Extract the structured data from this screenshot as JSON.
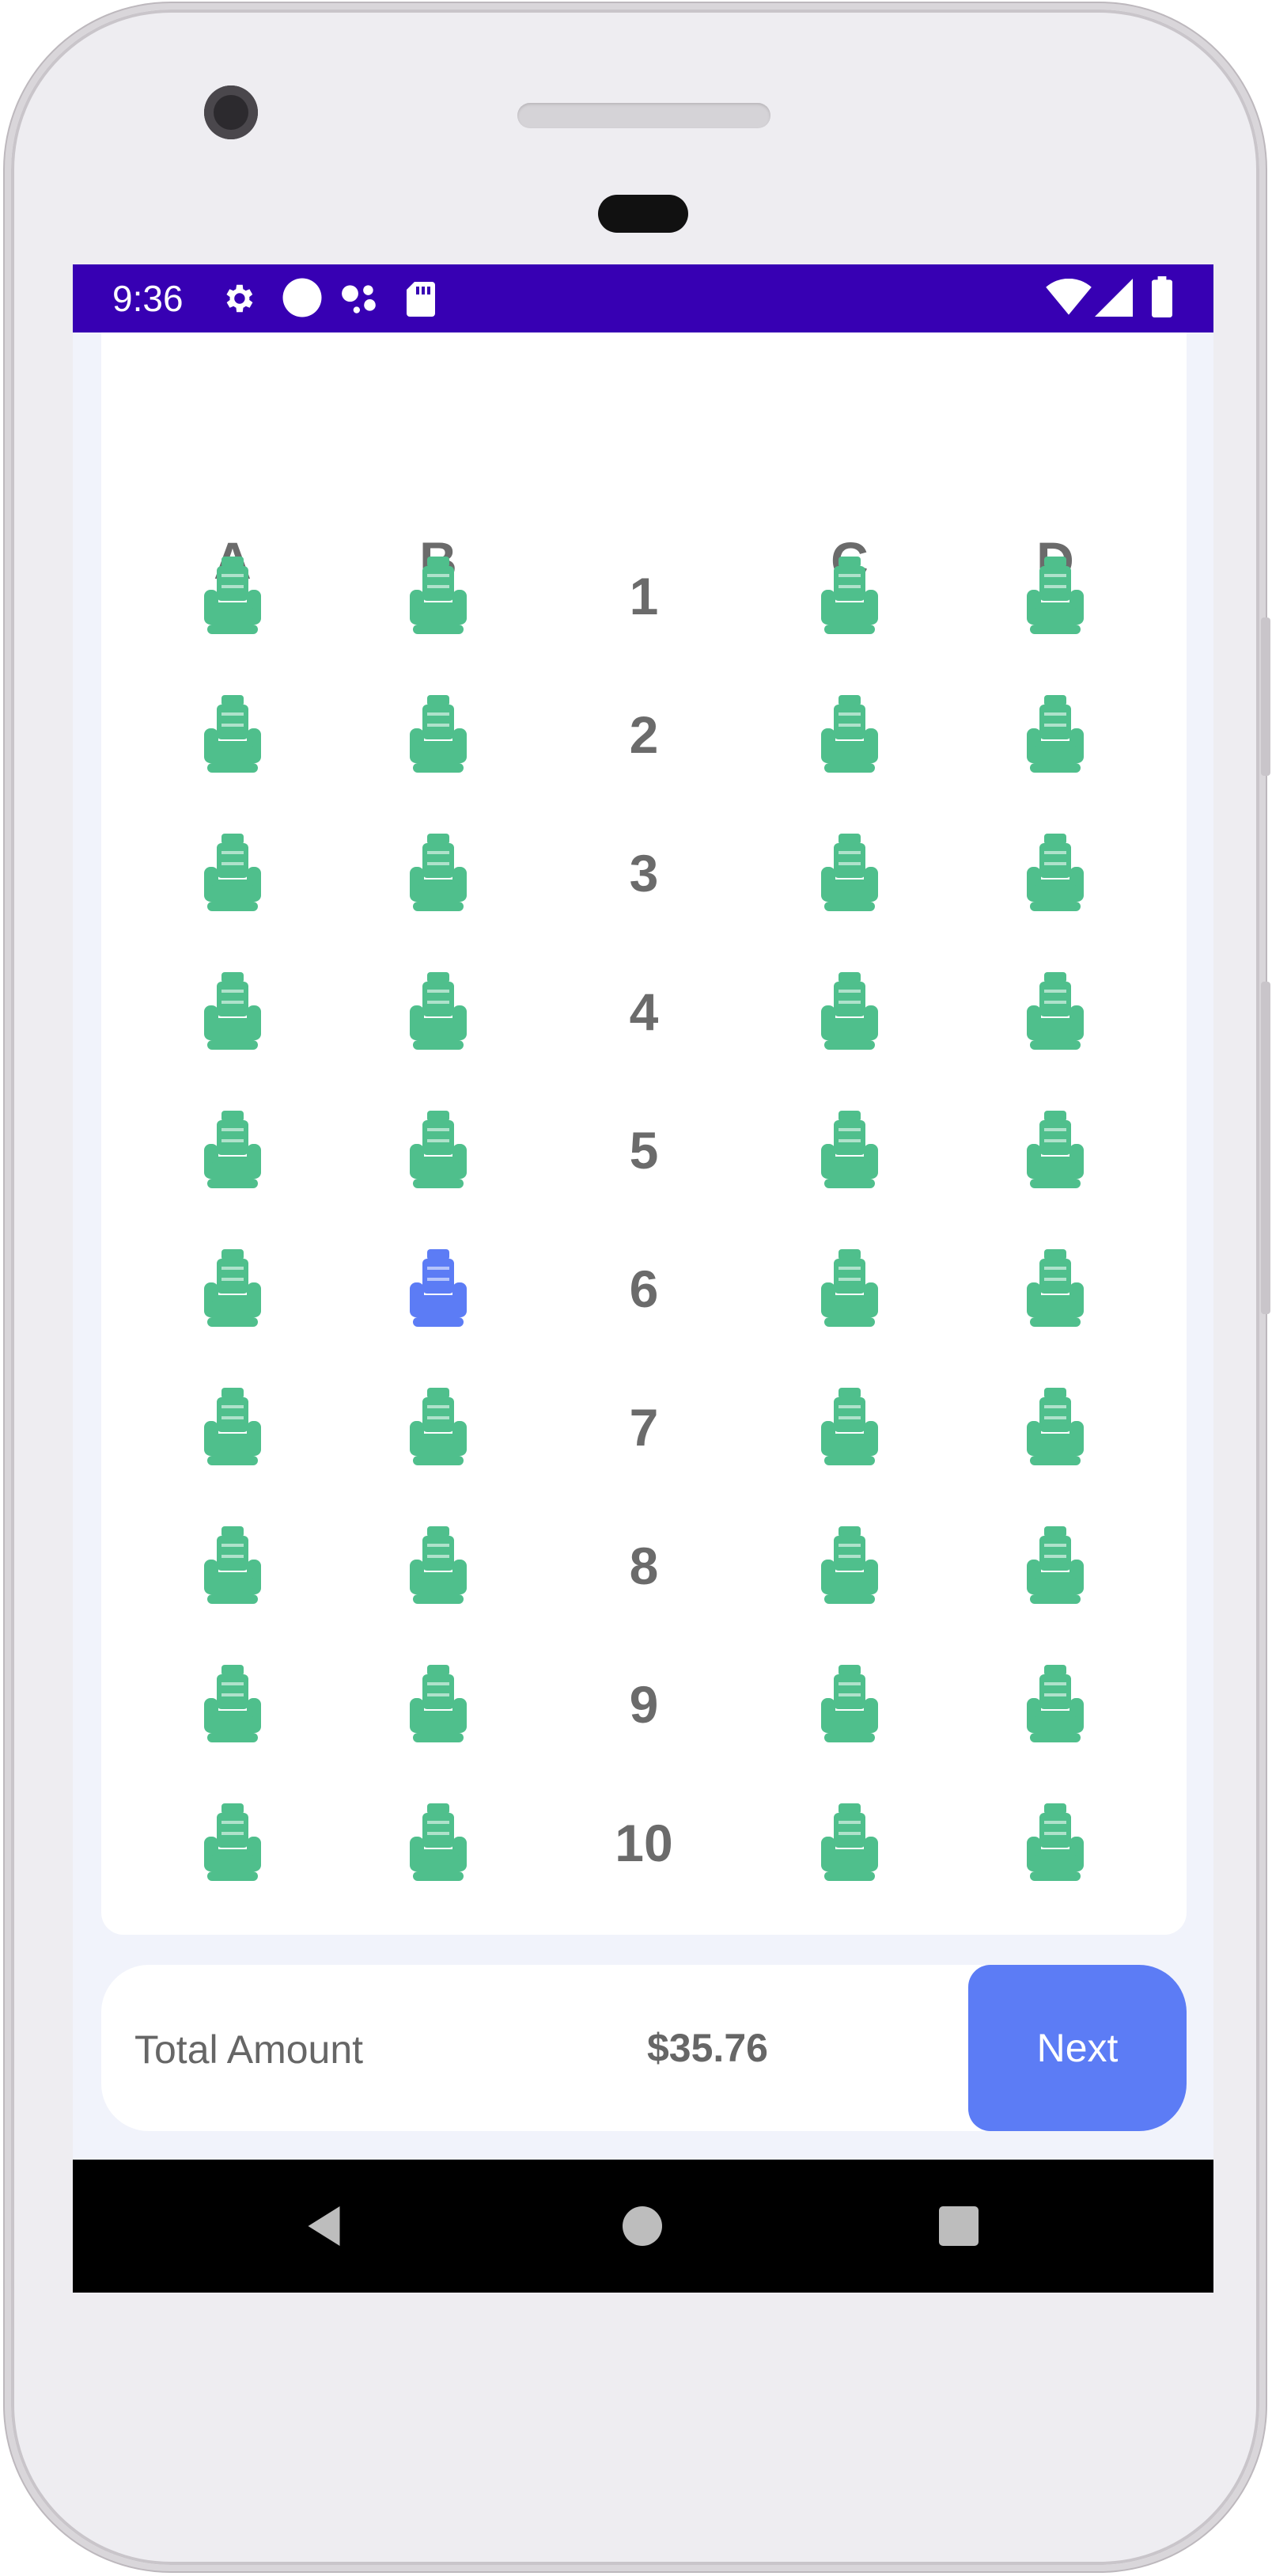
{
  "status_bar": {
    "time": "9:36",
    "left_icons": [
      "gear-icon",
      "circle-icon",
      "assistant-dots-icon",
      "sd-card-icon"
    ],
    "right_icons": [
      "wifi-icon",
      "signal-icon",
      "battery-icon"
    ],
    "background": "#3700b3"
  },
  "seat_map": {
    "columns": [
      "A",
      "B",
      "C",
      "D"
    ],
    "rows": [
      "1",
      "2",
      "3",
      "4",
      "5",
      "6",
      "7",
      "8",
      "9",
      "10"
    ],
    "available_color": "#4fbf8c",
    "selected_color": "#5c7cf5",
    "selected_seats": [
      "6B"
    ]
  },
  "footer": {
    "total_label": "Total Amount",
    "total_value": "$35.76",
    "next_label": "Next"
  },
  "nav_bar": {
    "icons": [
      "back-icon",
      "home-icon",
      "recents-icon"
    ]
  }
}
